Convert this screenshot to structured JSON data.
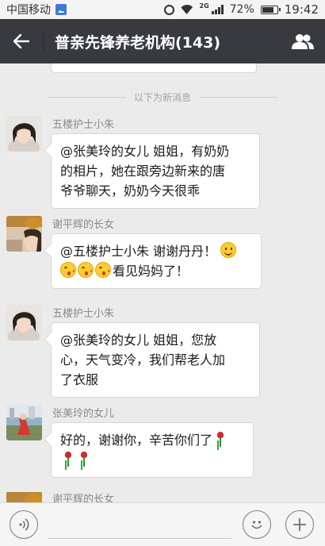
{
  "status_bar": {
    "carrier": "中国移动",
    "network": "2G",
    "battery": "72%",
    "time": "19:42"
  },
  "header": {
    "back_icon": "back-arrow-icon",
    "title": "普亲先锋养老机构(143)",
    "members_icon": "group-members-icon",
    "background": "#393a3f"
  },
  "chat": {
    "new_messages_divider": "以下为新消息",
    "messages": [
      {
        "sender": "五楼护士小朱",
        "lines": [
          "@张美玲的女儿 姐姐，有奶奶",
          "的相片，她在跟旁边新来的唐",
          "爷爷聊天，奶奶今天很乖"
        ]
      },
      {
        "sender": "谢平辉的长女",
        "line1": "@五楼护士小朱 谢谢丹丹！",
        "line2": "看见妈妈了！",
        "emojis": [
          "smile-emoji",
          "kiss-emoji",
          "kiss-emoji",
          "kiss-emoji"
        ]
      },
      {
        "sender": "五楼护士小朱",
        "lines": [
          "@张美玲的女儿 姐姐，您放",
          "心，天气变冷，我们帮老人加",
          "了衣服"
        ]
      },
      {
        "sender": "张美玲的女儿",
        "line1": "好的，谢谢你，辛苦你们了",
        "emojis": [
          "rose-emoji",
          "rose-emoji",
          "rose-emoji"
        ]
      },
      {
        "sender": "谢平辉的长女"
      }
    ]
  },
  "input_bar": {
    "voice_icon": "voice-icon",
    "text_value": "",
    "emoji_icon": "emoji-icon",
    "plus_icon": "plus-icon"
  }
}
